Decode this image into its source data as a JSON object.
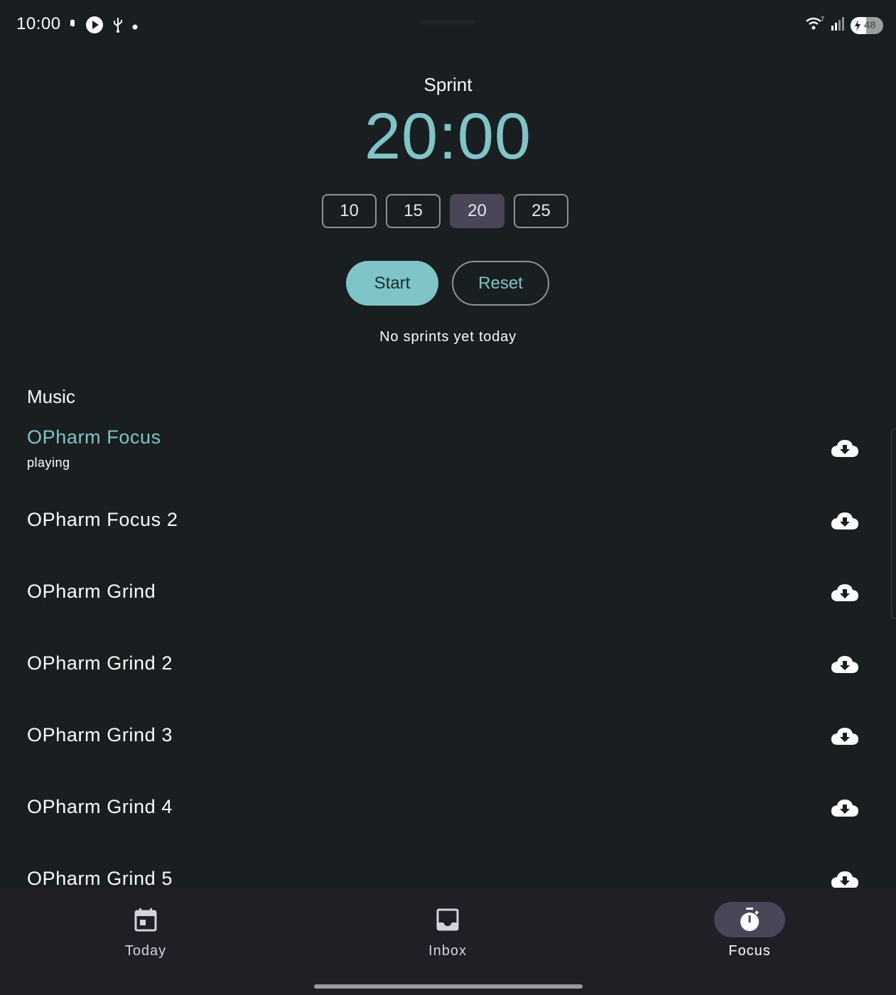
{
  "status_bar": {
    "time": "10:00",
    "battery_level": "48",
    "battery_fraction": 0.48,
    "icons_left": [
      "notification-icon",
      "play-icon",
      "usb-icon",
      "dot-icon"
    ],
    "icons_right": [
      "wifi-icon",
      "signal-icon",
      "battery-icon"
    ]
  },
  "sprint": {
    "title": "Sprint",
    "time": "20:00",
    "durations": [
      "10",
      "15",
      "20",
      "25"
    ],
    "selected_duration": "20",
    "start_label": "Start",
    "reset_label": "Reset",
    "status_text": "No sprints yet today"
  },
  "music": {
    "header": "Music",
    "tracks": [
      {
        "title": "OPharm Focus",
        "subtitle": "playing",
        "active": true
      },
      {
        "title": "OPharm Focus 2",
        "subtitle": "",
        "active": false
      },
      {
        "title": "OPharm Grind",
        "subtitle": "",
        "active": false
      },
      {
        "title": "OPharm Grind 2",
        "subtitle": "",
        "active": false
      },
      {
        "title": "OPharm Grind 3",
        "subtitle": "",
        "active": false
      },
      {
        "title": "OPharm Grind 4",
        "subtitle": "",
        "active": false
      },
      {
        "title": "OPharm Grind 5",
        "subtitle": "",
        "active": false
      }
    ],
    "download_icon": "cloud-download-icon"
  },
  "nav": {
    "items": [
      {
        "label": "Today",
        "icon": "calendar-icon",
        "active": false
      },
      {
        "label": "Inbox",
        "icon": "inbox-icon",
        "active": false
      },
      {
        "label": "Focus",
        "icon": "timer-icon",
        "active": true
      }
    ]
  },
  "colors": {
    "background": "#191f20",
    "accent": "#7fc4c6",
    "selected_chip": "#4a4658",
    "nav_background": "#211f26"
  }
}
